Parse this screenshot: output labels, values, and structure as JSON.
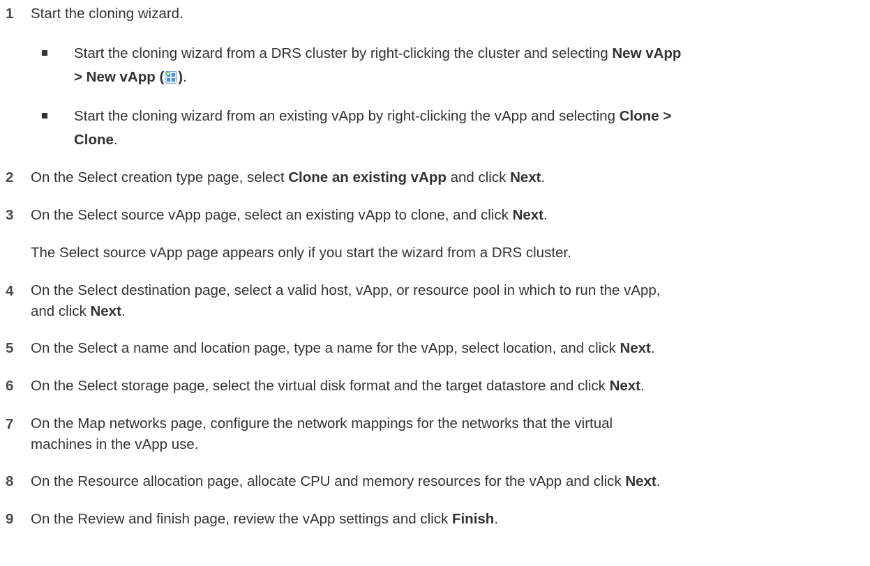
{
  "steps": [
    {
      "num": "1",
      "text": "Start the cloning wizard."
    },
    {
      "num": "2",
      "a": "On the Select creation type page, select ",
      "b1": "Clone an existing vApp",
      "c": " and click ",
      "b2": "Next",
      "d": "."
    },
    {
      "num": "3",
      "a": "On the Select source vApp page, select an existing vApp to clone, and click ",
      "b1": "Next",
      "c": ".",
      "note": "The Select source vApp page appears only if you start the wizard from a DRS cluster."
    },
    {
      "num": "4",
      "line1": "On the Select destination page, select a valid host, vApp, or resource pool in which to run the vApp,",
      "a": "and click ",
      "b1": "Next",
      "c": "."
    },
    {
      "num": "5",
      "a": "On the Select a name and location page, type a name for the vApp, select location, and click ",
      "b1": "Next",
      "c": "."
    },
    {
      "num": "6",
      "a": "On the Select storage page, select the virtual disk format and the target datastore and click ",
      "b1": "Next",
      "c": "."
    },
    {
      "num": "7",
      "line1": "On the Map networks page, configure the network mappings for the networks that the virtual",
      "line2": "machines in the vApp use."
    },
    {
      "num": "8",
      "a": "On the Resource allocation page, allocate CPU and memory resources for the vApp and click ",
      "b1": "Next",
      "c": "."
    },
    {
      "num": "9",
      "a": "On the Review and finish page, review the vApp settings and click ",
      "b1": "Finish",
      "c": "."
    }
  ],
  "substeps": [
    {
      "a": "Start the cloning wizard from a DRS cluster by right-clicking the cluster and selecting ",
      "b1": "New vApp",
      "b2": "> New vApp (",
      "b3": ")",
      "c": ".",
      "icon": "new-vapp-icon"
    },
    {
      "a": "Start the cloning wizard from an existing vApp by right-clicking the vApp and selecting ",
      "b1": "Clone >",
      "b2": "Clone",
      "c": "."
    }
  ]
}
